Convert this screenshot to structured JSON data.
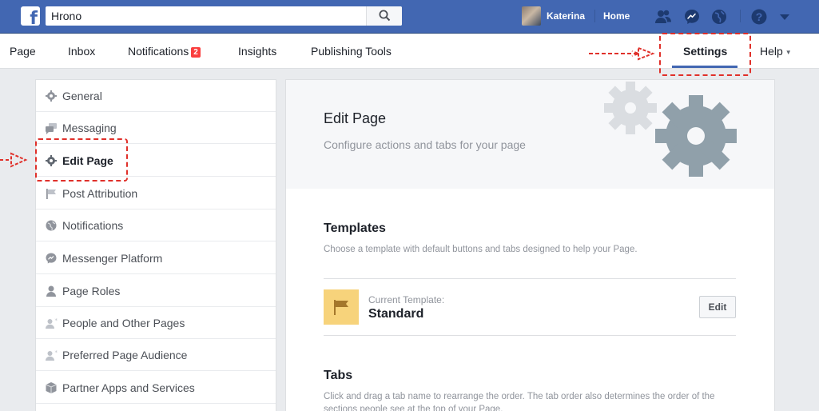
{
  "topbar": {
    "search_value": "Hrono",
    "user_name": "Katerina",
    "home_label": "Home"
  },
  "page_nav": {
    "page": "Page",
    "inbox": "Inbox",
    "notifications": "Notifications",
    "notifications_badge": "2",
    "insights": "Insights",
    "publishing_tools": "Publishing Tools",
    "settings": "Settings",
    "help": "Help"
  },
  "sidebar": {
    "items": [
      {
        "label": "General",
        "icon": "gear-icon"
      },
      {
        "label": "Messaging",
        "icon": "chat-bubbles-icon"
      },
      {
        "label": "Edit Page",
        "icon": "gear-icon"
      },
      {
        "label": "Post Attribution",
        "icon": "flag-icon"
      },
      {
        "label": "Notifications",
        "icon": "globe-icon"
      },
      {
        "label": "Messenger Platform",
        "icon": "messenger-icon"
      },
      {
        "label": "Page Roles",
        "icon": "person-icon"
      },
      {
        "label": "People and Other Pages",
        "icon": "person-star-icon"
      },
      {
        "label": "Preferred Page Audience",
        "icon": "person-star-icon"
      },
      {
        "label": "Partner Apps and Services",
        "icon": "box-icon"
      }
    ],
    "active_index": 2
  },
  "main": {
    "title": "Edit Page",
    "subtitle": "Configure actions and tabs for your page",
    "templates_title": "Templates",
    "templates_desc": "Choose a template with default buttons and tabs designed to help your Page.",
    "current_template_label": "Current Template:",
    "current_template_name": "Standard",
    "edit_button": "Edit",
    "tabs_title": "Tabs",
    "tabs_desc": "Click and drag a tab name to rearrange the order. The tab order also determines the order of the sections people see at the top of your Page."
  },
  "colors": {
    "brand_blue": "#4267b2",
    "annotation_red": "#e0302a",
    "template_icon_bg": "#f7d37b"
  }
}
